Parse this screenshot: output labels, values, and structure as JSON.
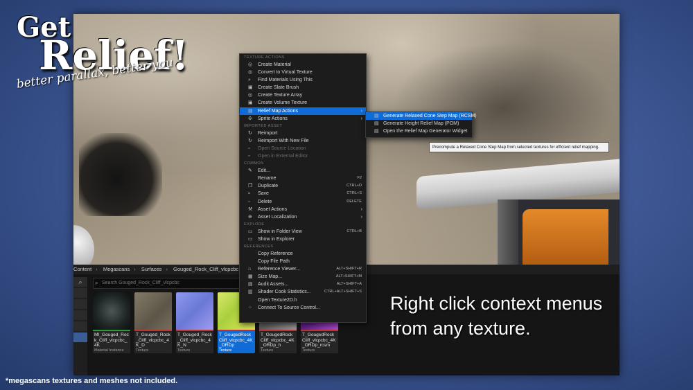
{
  "brand": {
    "line1": "Get",
    "line2": "Relief!",
    "tagline": "better parallax, better you"
  },
  "caption": {
    "line1": "Right click context menus",
    "line2": "from any texture."
  },
  "footnote": "*megascans textures and meshes not included.",
  "breadcrumb": [
    "Content",
    "Megascans",
    "Surfaces",
    "Gouged_Rock_Cliff_vlcpcbc"
  ],
  "search_placeholder": "Search Gouged_Rock_Cliff_vlcpcbc",
  "assets": [
    {
      "name": "MI_Gouged_Rock_Cliff_vlcpcbc_4K",
      "type": "Material Instance",
      "color": "#1e2424",
      "strip": "#2f9a3a"
    },
    {
      "name": "T_Gouged_Rock_Cliff_vlcpcbc_4K_D",
      "type": "Texture",
      "color": "#6e6656",
      "strip": "#c23030"
    },
    {
      "name": "T_Gouged_Rock_Cliff_vlcpcbc_4K_N",
      "type": "Texture",
      "color": "#7d8be0",
      "strip": "#c23030"
    },
    {
      "name": "T_GougedRock Cliff_vlcpcbc_4K_ORDp",
      "type": "Texture",
      "color": "#b6d64a",
      "strip": "#c23030"
    },
    {
      "name": "T_GougedRock Cliff_vlcpcbc_4K_ORDp_h",
      "type": "Texture",
      "color": "#777777",
      "strip": "#c23030"
    },
    {
      "name": "T_GougedRock Cliff_vlcpcbc_4K_ORDp_rcsm",
      "type": "Texture",
      "color": "#7a2fa0",
      "strip": "#c23030"
    }
  ],
  "menu": {
    "texture_actions": "TEXTURE ACTIONS",
    "create_material": "Create Material",
    "convert_virtual": "Convert to Virtual Texture",
    "find_materials": "Find Materials Using This",
    "create_slate_brush": "Create Slate Brush",
    "create_texture_array": "Create Texture Array",
    "create_volume_texture": "Create Volume Texture",
    "relief_map_actions": "Relief Map Actions",
    "sprite_actions": "Sprite Actions",
    "imported_asset": "IMPORTED ASSET",
    "reimport": "Reimport",
    "reimport_new_file": "Reimport With New File",
    "open_source_location": "Open Source Location",
    "open_external_editor": "Open in External Editor",
    "common": "COMMON",
    "edit": "Edit...",
    "rename": "Rename",
    "rename_sc": "F2",
    "duplicate": "Duplicate",
    "duplicate_sc": "CTRL+D",
    "save": "Save",
    "save_sc": "CTRL+S",
    "delete": "Delete",
    "delete_sc": "DELETE",
    "asset_actions": "Asset Actions",
    "asset_localization": "Asset Localization",
    "explore": "EXPLORE",
    "show_folder_view": "Show in Folder View",
    "show_folder_view_sc": "CTRL+B",
    "show_explorer": "Show in Explorer",
    "references": "REFERENCES",
    "copy_reference": "Copy Reference",
    "copy_file_path": "Copy File Path",
    "reference_viewer": "Reference Viewer...",
    "reference_viewer_sc": "ALT+SHIFT+R",
    "size_map": "Size Map...",
    "size_map_sc": "ALT+SHIFT+M",
    "audit_assets": "Audit Assets...",
    "audit_assets_sc": "ALT+SHIFT+A",
    "shader_cook": "Shader Cook Statistics...",
    "shader_cook_sc": "CTRL+ALT+SHIFT+S",
    "open_texture2d": "Open Texture2D.h",
    "connect_source": "Connect To Source Control..."
  },
  "submenu": {
    "generate_rcsm": "Generate Relaxed Cone Step Map (RCSM)",
    "generate_pom": "Generate Height Relief Map (POM)",
    "open_widget": "Open the Relief Map Generator Widget"
  },
  "tooltip": "Precompute a Relaxed Cone Step Map from selected textures for efficient relief mapping.",
  "colors": {
    "accent": "#0f6bd6",
    "menu_bg": "#1c1c1c",
    "background": "#3b548f"
  }
}
